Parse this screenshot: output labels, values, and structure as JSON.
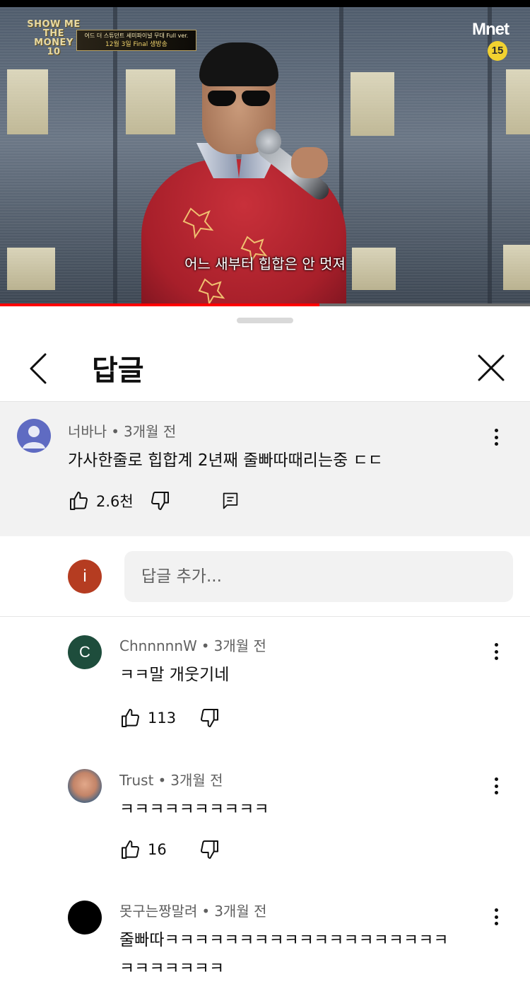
{
  "video": {
    "show_logo_lines": [
      "SHOW ME",
      "THE MONEY",
      "10"
    ],
    "banner_line1": "어드 더 스튜던트 세미파이널 무대 Full ver.",
    "banner_line2": "12월 3일 Final 생방송",
    "channel_logo": "Mnet",
    "age_rating": "15",
    "subtitle": "어느 새부터 힙합은 안 멋져",
    "progress_fraction": 0.603,
    "progress_color": "#ff0000"
  },
  "sheet": {
    "title": "답글",
    "back_icon": "chevron-left-icon",
    "close_icon": "close-icon"
  },
  "parent_comment": {
    "author": "너바나",
    "time": "3개월 전",
    "text": "가사한줄로 힙합계 2년째 줄빠따때리는중 ㄷㄷ",
    "likes": "2.6천",
    "avatar": "default-user-avatar"
  },
  "reply_input": {
    "avatar_initial": "i",
    "placeholder": "답글 추가..."
  },
  "replies": [
    {
      "author": "ChnnnnnW",
      "time": "3개월 전",
      "text": "ㅋㅋ말 개웃기네",
      "likes": "113",
      "avatar_initial": "C"
    },
    {
      "author": "Trust",
      "time": "3개월 전",
      "text": "ㅋㅋㅋㅋㅋㅋㅋㅋㅋㅋ",
      "likes": "16",
      "avatar_initial": ""
    },
    {
      "author": "못구는짱말려",
      "time": "3개월 전",
      "text_line1": "줄빠따ㅋㅋㅋㅋㅋㅋㅋㅋㅋㅋㅋㅋㅋㅋㅋㅋㅋㅋㅋ",
      "text_line2": "ㅋㅋㅋㅋㅋㅋㅋ",
      "avatar_initial": ""
    }
  ],
  "colors": {
    "secondary_text": "#606060",
    "primary_text": "#0f0f0f",
    "highlight_bg": "#f2f2f2"
  }
}
